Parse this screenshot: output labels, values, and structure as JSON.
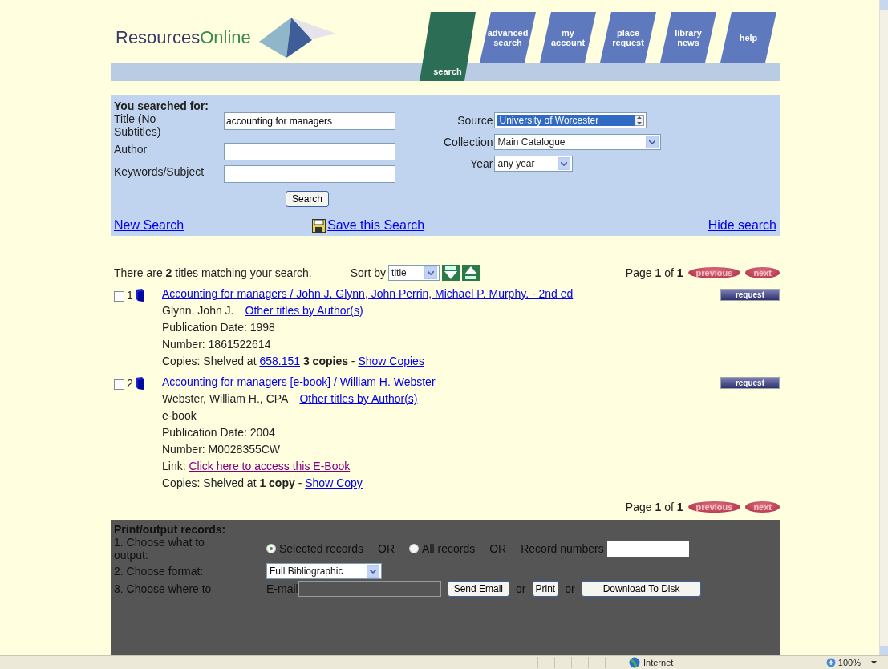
{
  "header": {
    "logo": {
      "part_1": "Resources",
      "part_2": "Online"
    },
    "tabs": [
      {
        "label": "search",
        "selected": true
      },
      {
        "label": "advanced search",
        "selected": false
      },
      {
        "label": "my account",
        "selected": false
      },
      {
        "label": "place request",
        "selected": false
      },
      {
        "label": "library news",
        "selected": false
      },
      {
        "label": "help",
        "selected": false
      }
    ]
  },
  "search_form": {
    "heading": "You searched for:",
    "fields": [
      {
        "label": "Title (No Subtitles)",
        "value": "accounting for managers"
      },
      {
        "label": "Author"
      },
      {
        "label": "Keywords/Subject"
      }
    ],
    "selects": [
      {
        "label": "Source",
        "value": "University of Worcester",
        "kind": "listbox"
      },
      {
        "label": "Collection",
        "value": "Main Catalogue",
        "kind": "dropdown"
      },
      {
        "label": "Year",
        "value": "any year",
        "kind": "dropdown"
      }
    ],
    "button": "Search",
    "new_search": "New Search",
    "save_search": "Save this Search",
    "hide_search": "Hide search"
  },
  "results": {
    "summary": "There are **2** titles matching your search.",
    "sort_label": "Sort by",
    "sort_value": "title",
    "pager": "Page **1** of **1**",
    "previous": "previous",
    "next": "next",
    "records": [
      {
        "number": "1",
        "checked": false,
        "title": "Accounting for managers / John J. Glynn, John Perrin, Michael P. Murphy. - 2nd ed",
        "request": "request",
        "author": "Glynn, John J.",
        "other_titles": "Other titles by Author(s)",
        "lines": [
          {
            "kind": "text",
            "text": "Publication Date: 1998"
          },
          {
            "kind": "text",
            "text": "Number: 1861522614"
          },
          {
            "kind": "copies",
            "label": "Copies:  Shelved at",
            "shelf": "658.151",
            "count": "3 copies",
            "separator": "-",
            "link": "Show Copies"
          }
        ]
      },
      {
        "number": "2",
        "checked": false,
        "title": "Accounting for managers [e-book] / William H. Webster",
        "request": "request",
        "author": "Webster, William H., CPA",
        "other_titles": "Other titles by Author(s)",
        "lines": [
          {
            "kind": "text",
            "text": "e-book"
          },
          {
            "kind": "text",
            "text": "Publication Date: 2004"
          },
          {
            "kind": "text",
            "text": "Number: M0028355CW"
          },
          {
            "kind": "link",
            "label": "Link:",
            "link": "Click here to access this E-Book"
          },
          {
            "kind": "copies",
            "label": "Copies:  Shelved at ",
            "count": "1 copy",
            "separator": "-",
            "link": "Show Copy"
          }
        ]
      }
    ],
    "footer_pager": "Page **1** of **1**",
    "footer_previous": "previous",
    "footer_next": "next"
  },
  "output_panel": {
    "heading": "Print/output records:",
    "step_1": "1.  Choose what to output:",
    "options": [
      {
        "label": "Selected records",
        "selected": true
      },
      {
        "label": "All records",
        "selected": false
      }
    ],
    "or_1": "OR",
    "or_2": "OR",
    "record_numbers": "Record numbers",
    "step_2": "2.  Choose format:",
    "format": "Full Bibliographic",
    "step_3": "3.  Choose where to",
    "email_label": "E-mail",
    "send_email": "Send Email",
    "or_3": "or",
    "print": "Print",
    "or_4": "or",
    "download": "Download To Disk"
  },
  "status_bar": {
    "zone": "Internet",
    "zoom": "100%"
  }
}
